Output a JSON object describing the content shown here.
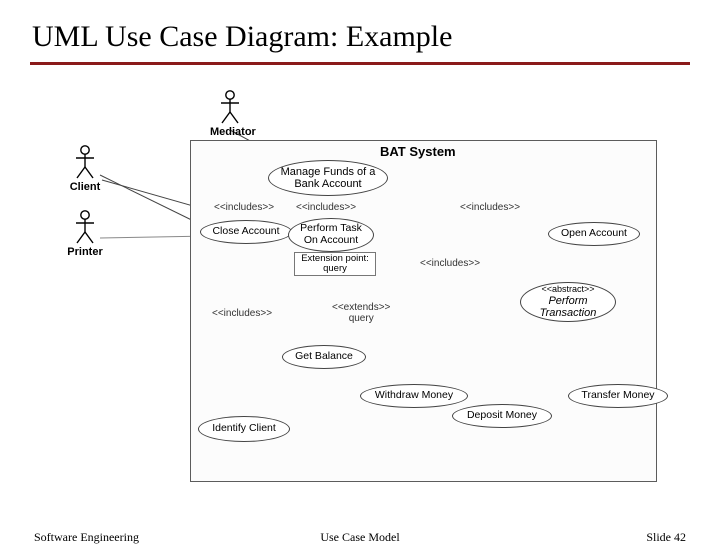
{
  "title": "UML Use Case Diagram: Example",
  "system_label": "BAT System",
  "actors": {
    "mediator": "Mediator",
    "client": "Client",
    "printer": "Printer"
  },
  "usecases": {
    "manage_funds": "Manage Funds of a\nBank Account",
    "close_account": "Close Account",
    "perform_task": "Perform Task\nOn Account",
    "open_account": "Open Account",
    "perform_transaction_stereo": "<<abstract>>",
    "perform_transaction": "Perform\nTransaction",
    "get_balance": "Get Balance",
    "withdraw_money": "Withdraw Money",
    "deposit_money": "Deposit Money",
    "transfer_money": "Transfer Money",
    "identify_client": "Identify Client"
  },
  "ext_point": "Extension point:\nquery",
  "rel": {
    "includes": "<<includes>>",
    "extends_query": "<<extends>>\nquery"
  },
  "footer": {
    "left": "Software Engineering",
    "center": "Use Case Model",
    "right": "Slide 42"
  }
}
